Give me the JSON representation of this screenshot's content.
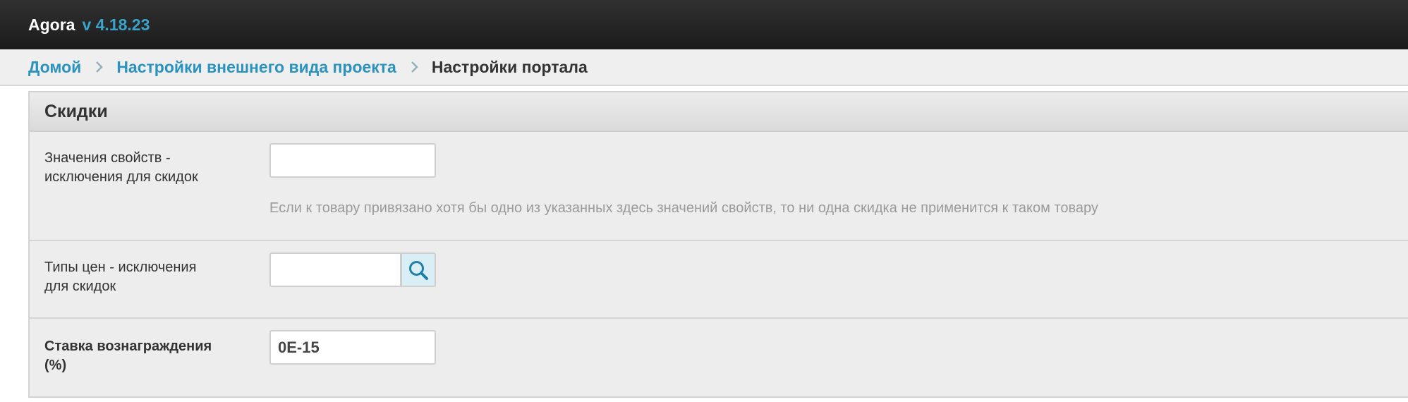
{
  "header": {
    "app_name": "Agora",
    "version": "v 4.18.23"
  },
  "breadcrumb": {
    "items": [
      {
        "label": "Домой"
      },
      {
        "label": "Настройки внешнего вида проекта"
      },
      {
        "label": "Настройки портала"
      }
    ]
  },
  "panel": {
    "title": "Скидки",
    "rows": [
      {
        "label_line1": "Значения свойств -",
        "label_line2": "исключения для скидок",
        "value": "",
        "hint": "Если к товару привязано хотя бы одно из указанных здесь значений свойств, то ни одна скидка не применится к таком товару"
      },
      {
        "label_line1": "Типы цен - исключения",
        "label_line2": "для скидок",
        "value": "",
        "button_icon": "search-icon"
      },
      {
        "label_line1": "Ставка вознаграждения",
        "label_line2": "(%)",
        "value": "0E-15"
      }
    ]
  },
  "colors": {
    "accent": "#2a92bf",
    "version": "#3aa3c9",
    "topbar": "#232323",
    "panel_bg": "#ededed"
  }
}
